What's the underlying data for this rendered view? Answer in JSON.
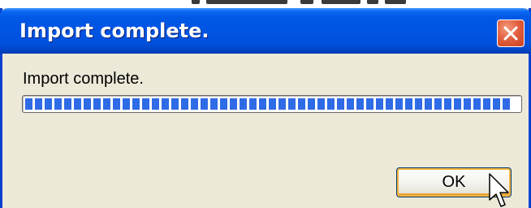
{
  "window": {
    "title": "Import complete.",
    "close_icon": "close-icon",
    "titlebar_color": "#0054e3",
    "close_color": "#e36140"
  },
  "content": {
    "message": "Import complete.",
    "progress": {
      "value_percent": 100,
      "segment_color": "#2f6be6"
    }
  },
  "buttons": {
    "ok_label": "OK"
  },
  "cursor": {
    "icon": "mouse-pointer-icon"
  }
}
